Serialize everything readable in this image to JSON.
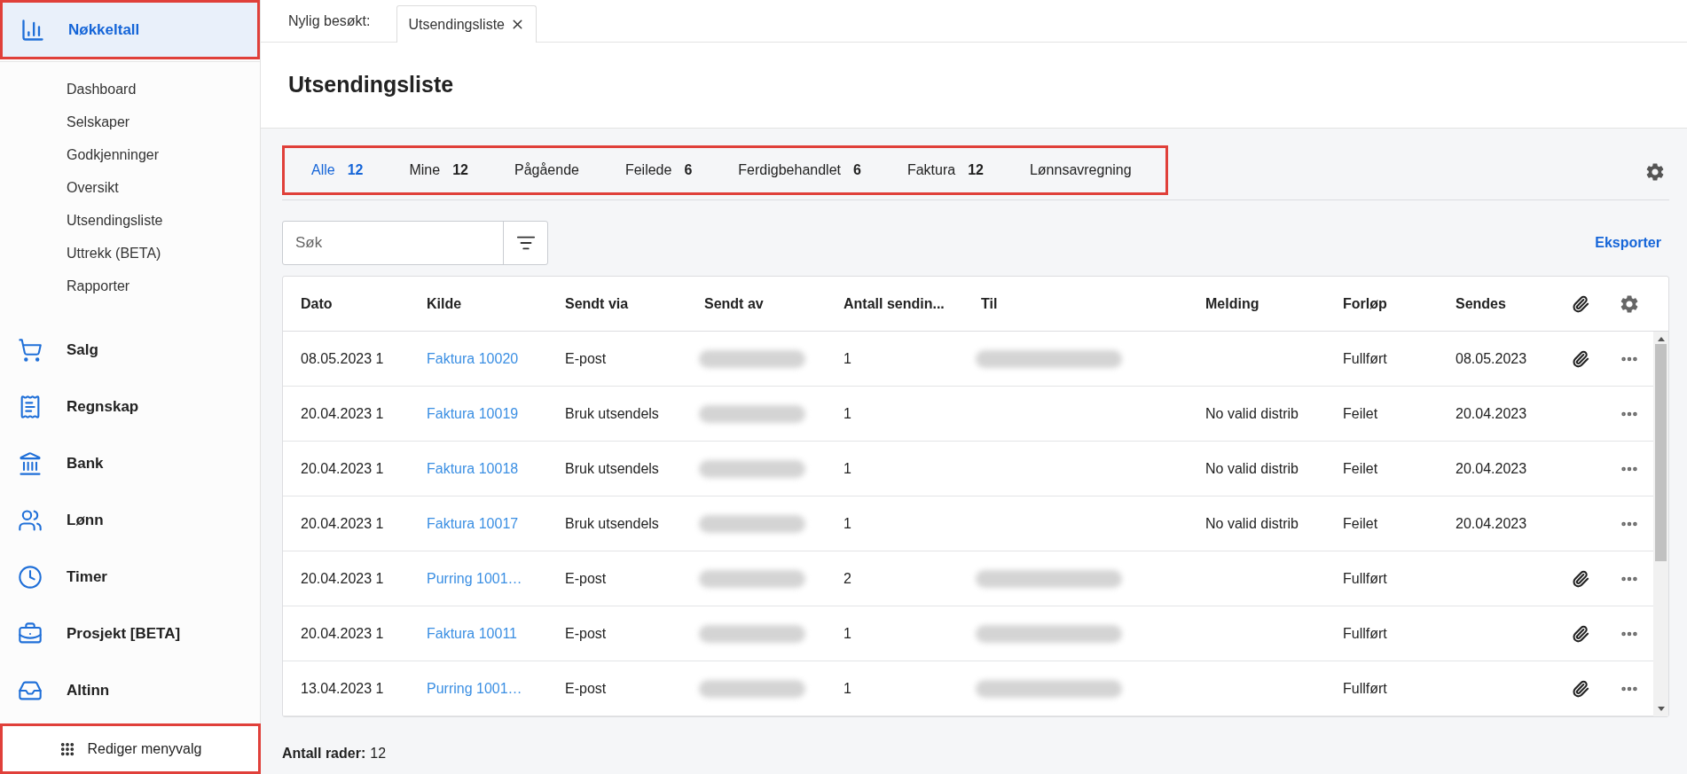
{
  "sidebar": {
    "top_item": {
      "label": "Nøkkeltall",
      "selected": true,
      "highlighted": true
    },
    "sub_items": [
      "Dashboard",
      "Selskaper",
      "Godkjenninger",
      "Oversikt",
      "Utsendingsliste",
      "Uttrekk (BETA)",
      "Rapporter"
    ],
    "items": [
      {
        "label": "Salg",
        "kind": "cart"
      },
      {
        "label": "Regnskap",
        "kind": "ledger"
      },
      {
        "label": "Bank",
        "kind": "bank"
      },
      {
        "label": "Lønn",
        "kind": "people"
      },
      {
        "label": "Timer",
        "kind": "clock"
      },
      {
        "label": "Prosjekt [BETA]",
        "kind": "briefcase"
      },
      {
        "label": "Altinn",
        "kind": "inbox"
      }
    ],
    "edit_button": {
      "label": "Rediger menyvalg",
      "highlighted": true
    }
  },
  "recent_bar": {
    "label": "Nylig besøkt:",
    "tabs": [
      "Utsendingsliste"
    ]
  },
  "page_title": "Utsendingsliste",
  "tabs_highlighted": true,
  "tabs": [
    {
      "label": "Alle",
      "count": "12",
      "selected": true
    },
    {
      "label": "Mine",
      "count": "12",
      "selected": false
    },
    {
      "label": "Pågående",
      "selected": false
    },
    {
      "label": "Feilede",
      "count": "6",
      "selected": false
    },
    {
      "label": "Ferdigbehandlet",
      "count": "6",
      "selected": false
    },
    {
      "label": "Faktura",
      "count": "12",
      "selected": false
    },
    {
      "label": "Lønnsavregning",
      "selected": false
    }
  ],
  "search": {
    "placeholder": "Søk"
  },
  "export_link": "Eksporter",
  "table": {
    "columns": [
      "Dato",
      "Kilde",
      "Sendt via",
      "Sendt av",
      "Antall sendin...",
      "Til",
      "Melding",
      "Forløp",
      "Sendes"
    ],
    "rows": [
      {
        "dato": "08.05.2023 1",
        "kilde": "Faktura 10020",
        "sendt_via": "E-post",
        "sendt_av_redacted": true,
        "antall": "1",
        "til_redacted": true,
        "melding": "",
        "forlop": "Fullført",
        "sendes": "08.05.2023",
        "attachment": true
      },
      {
        "dato": "20.04.2023 1",
        "kilde": "Faktura 10019",
        "sendt_via": "Bruk utsendels",
        "sendt_av_redacted": true,
        "antall": "1",
        "til_redacted": false,
        "melding": "No valid distrib",
        "forlop": "Feilet",
        "sendes": "20.04.2023",
        "attachment": false
      },
      {
        "dato": "20.04.2023 1",
        "kilde": "Faktura 10018",
        "sendt_via": "Bruk utsendels",
        "sendt_av_redacted": true,
        "antall": "1",
        "til_redacted": false,
        "melding": "No valid distrib",
        "forlop": "Feilet",
        "sendes": "20.04.2023",
        "attachment": false
      },
      {
        "dato": "20.04.2023 1",
        "kilde": "Faktura 10017",
        "sendt_via": "Bruk utsendels",
        "sendt_av_redacted": true,
        "antall": "1",
        "til_redacted": false,
        "melding": "No valid distrib",
        "forlop": "Feilet",
        "sendes": "20.04.2023",
        "attachment": false
      },
      {
        "dato": "20.04.2023 1",
        "kilde": "Purring 1001…",
        "sendt_via": "E-post",
        "sendt_av_redacted": true,
        "antall": "2",
        "til_redacted": true,
        "melding": "",
        "forlop": "Fullført",
        "sendes": "",
        "attachment": true
      },
      {
        "dato": "20.04.2023 1",
        "kilde": "Faktura 10011",
        "sendt_via": "E-post",
        "sendt_av_redacted": true,
        "antall": "1",
        "til_redacted": true,
        "melding": "",
        "forlop": "Fullført",
        "sendes": "",
        "attachment": true
      },
      {
        "dato": "13.04.2023 1",
        "kilde": "Purring 1001…",
        "sendt_via": "E-post",
        "sendt_av_redacted": true,
        "antall": "1",
        "til_redacted": true,
        "melding": "",
        "forlop": "Fullført",
        "sendes": "",
        "attachment": true
      }
    ]
  },
  "footer": {
    "label": "Antall rader:",
    "value": "12"
  }
}
